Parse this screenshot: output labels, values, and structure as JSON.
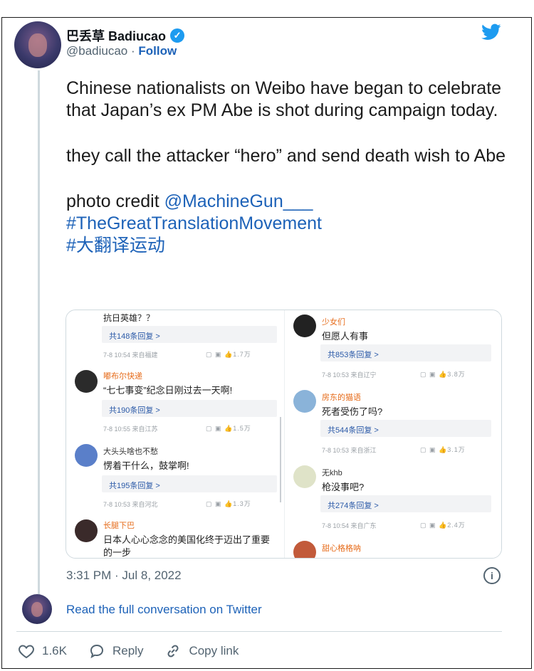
{
  "tweet": {
    "author_name": "巴丢草 Badiucao",
    "handle": "@badiucao",
    "separator": " · ",
    "follow_label": "Follow",
    "paragraphs": [
      "Chinese nationalists on Weibo have began to celebrate that Japan’s ex PM Abe is shot during campaign today.",
      "they call the attacker “hero” and send death wish to Abe"
    ],
    "credit_prefix": "photo credit ",
    "credit_mention": "@MachineGun___",
    "hashtags": [
      "#TheGreatTranslationMovement",
      "#大翻译运动"
    ],
    "timestamp": "3:31 PM · Jul 8, 2022",
    "read_full": "Read the full conversation on Twitter",
    "likes": "1.6K",
    "reply_label": "Reply",
    "copy_label": "Copy link",
    "icons": [
      "twitter-bird-icon",
      "verified-badge-icon",
      "info-icon",
      "heart-icon",
      "reply-bubble-icon",
      "link-icon"
    ],
    "colors": {
      "link": "#1d62b8",
      "verified": "#1d9bf0",
      "bird": "#1d9bf0",
      "muted": "#536471"
    }
  },
  "screenshot": {
    "left": {
      "top_text": "抗日英雄？？",
      "comments": [
        {
          "reply": "共148条回复 >",
          "meta": "7-8 10:54 来自福建",
          "likes": "1.7万"
        },
        {
          "name": "嘟布尔快递",
          "text": "“七七事变”纪念日刚过去一天啊!",
          "reply": "共190条回复 >",
          "meta": "7-8 10:55 来自江苏",
          "likes": "1.5万"
        },
        {
          "name": "大头头啥也不愁",
          "text": "愣着干什么，鼓掌啊!",
          "reply": "共195条回复 >",
          "meta": "7-8 10:53 来自河北",
          "likes": "1.3万"
        },
        {
          "name": "长腿下巴",
          "text": "日本人心心念念的美国化终于迈出了重要",
          "text2": "的一步"
        }
      ]
    },
    "right": {
      "comments": [
        {
          "name": "少女们",
          "text": "但愿人有事",
          "reply": "共853条回复 >",
          "meta": "7-8 10:53 来自辽宁",
          "likes": "3.8万"
        },
        {
          "name": "房东的猫语",
          "text": "死者受伤了吗?",
          "reply": "共544条回复 >",
          "meta": "7-8 10:53 来自浙江",
          "likes": "3.1万"
        },
        {
          "name": "无khb",
          "text": "枪没事吧?",
          "reply": "共274条回复 >",
          "meta": "7-8 10:54 来自广东",
          "likes": "2.4万"
        },
        {
          "name": "甜心格格呐"
        }
      ]
    }
  }
}
